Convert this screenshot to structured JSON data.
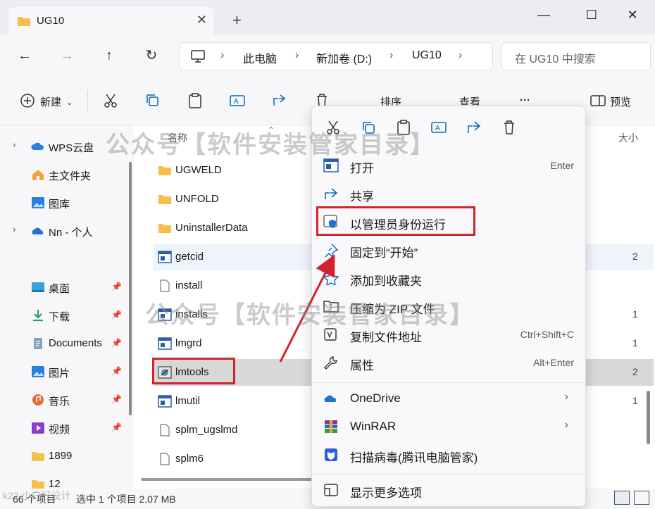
{
  "window": {
    "tab_title": "UG10",
    "new_tab": "+",
    "minimize": "—",
    "maximize": "☐",
    "close": "✕"
  },
  "nav": {
    "breadcrumb": [
      "此电脑",
      "新加卷 (D:)",
      "UG10"
    ],
    "search_placeholder": "在 UG10 中搜索"
  },
  "toolbar": {
    "new_label": "新建",
    "sort_label": "排序",
    "view_label": "查看",
    "more_label": "···",
    "preview_label": "预览"
  },
  "sidebar": {
    "items": [
      {
        "label": "WPS云盘",
        "icon": "cloud-icon",
        "chevron": true
      },
      {
        "label": "主文件夹",
        "icon": "home-icon",
        "chevron": false
      },
      {
        "label": "图库",
        "icon": "gallery-icon",
        "chevron": false
      },
      {
        "label": "Nn - 个人",
        "icon": "onedrive-icon",
        "chevron": true
      },
      {
        "label": "桌面",
        "icon": "desktop-icon",
        "pinned": true
      },
      {
        "label": "下载",
        "icon": "download-icon",
        "pinned": true
      },
      {
        "label": "Documents",
        "icon": "documents-icon",
        "pinned": true
      },
      {
        "label": "图片",
        "icon": "pictures-icon",
        "pinned": true
      },
      {
        "label": "音乐",
        "icon": "music-icon",
        "pinned": true
      },
      {
        "label": "视频",
        "icon": "video-icon",
        "pinned": true
      },
      {
        "label": "1899",
        "icon": "folder-icon",
        "pinned": false
      },
      {
        "label": "12",
        "icon": "folder-icon",
        "pinned": false
      }
    ]
  },
  "content": {
    "col_name": "名称",
    "col_size": "大小",
    "files": [
      {
        "name": "UGWELD",
        "type": "folder",
        "size": ""
      },
      {
        "name": "UNFOLD",
        "type": "folder",
        "size": ""
      },
      {
        "name": "UninstallerData",
        "type": "folder",
        "size": ""
      },
      {
        "name": "getcid",
        "type": "exe",
        "size": "2"
      },
      {
        "name": "install",
        "type": "doc",
        "size": ""
      },
      {
        "name": "installs",
        "type": "exe",
        "size": "1"
      },
      {
        "name": "lmgrd",
        "type": "exe",
        "size": "1"
      },
      {
        "name": "lmtools",
        "type": "lmtools",
        "size": "2"
      },
      {
        "name": "lmutil",
        "type": "exe",
        "size": "1"
      },
      {
        "name": "splm_ugslmd",
        "type": "doc",
        "size": ""
      },
      {
        "name": "splm6",
        "type": "doc",
        "size": ""
      }
    ]
  },
  "status": {
    "count": "66 个项目",
    "selected": "选中 1 个项目  2.07 MB"
  },
  "context_menu": {
    "items": [
      {
        "label": "打开",
        "shortcut": "Enter",
        "icon": "open-icon"
      },
      {
        "label": "共享",
        "shortcut": "",
        "icon": "share-icon"
      },
      {
        "label": "以管理员身份运行",
        "shortcut": "",
        "icon": "admin-shield-icon"
      },
      {
        "label": "固定到“开始”",
        "shortcut": "",
        "icon": "pin-icon"
      },
      {
        "label": "添加到收藏夹",
        "shortcut": "",
        "icon": "star-icon"
      },
      {
        "label": "压缩为 ZIP 文件",
        "shortcut": "",
        "icon": "zip-icon"
      },
      {
        "label": "复制文件地址",
        "shortcut": "Ctrl+Shift+C",
        "icon": "copy-path-icon"
      },
      {
        "label": "属性",
        "shortcut": "Alt+Enter",
        "icon": "properties-icon"
      },
      {
        "label": "OneDrive",
        "shortcut": "",
        "icon": "onedrive-icon",
        "submenu": true
      },
      {
        "label": "WinRAR",
        "shortcut": "",
        "icon": "winrar-icon",
        "submenu": true
      },
      {
        "label": "扫描病毒(腾讯电脑管家)",
        "shortcut": "",
        "icon": "antivirus-icon"
      },
      {
        "label": "显示更多选项",
        "shortcut": "",
        "icon": "more-options-icon"
      }
    ]
  },
  "watermark": {
    "text": "公众号【软件安装管家目录】",
    "corner": "k22 小白好设计"
  },
  "colors": {
    "accent": "#0067c0",
    "annotation": "#d0242a",
    "folder": "#f5c04a"
  }
}
